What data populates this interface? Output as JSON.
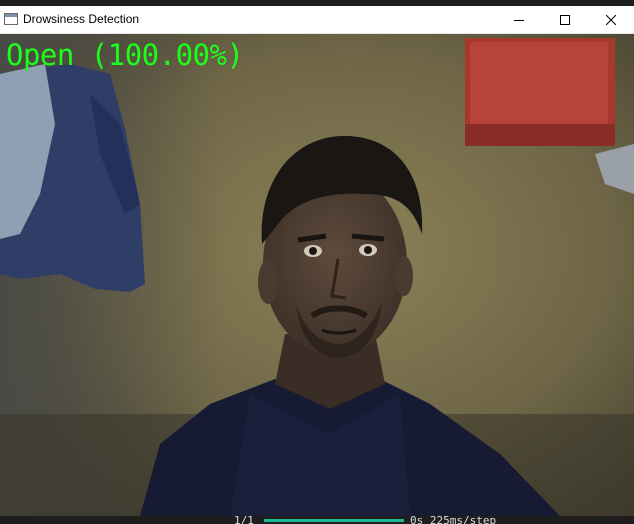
{
  "window": {
    "title": "Drowsiness Detection",
    "icons": {
      "app": "app-window-icon",
      "minimize": "minimize-icon",
      "maximize": "maximize-icon",
      "close": "close-icon"
    }
  },
  "feed": {
    "status_text": "Open (100.00%)",
    "status_color": "#1aff1a"
  },
  "terminal": {
    "step": "1/1",
    "progress": 1.0,
    "timing": "0s 225ms/step",
    "progress_color": "#1bb89a"
  }
}
